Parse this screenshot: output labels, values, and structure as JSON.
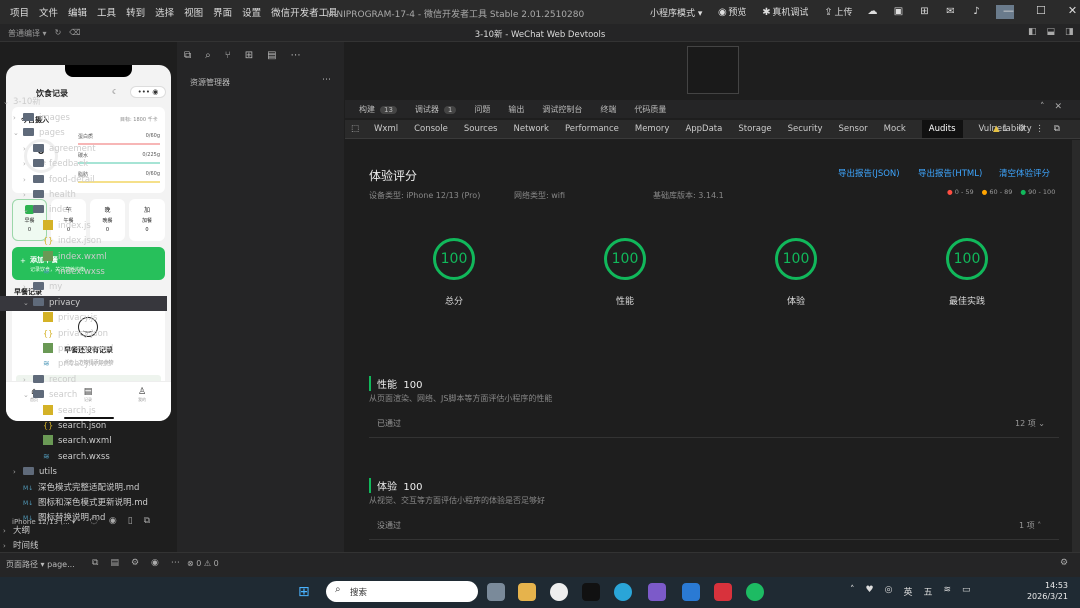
{
  "menu": [
    "项目",
    "文件",
    "编辑",
    "工具",
    "转到",
    "选择",
    "视图",
    "界面",
    "设置",
    "微信开发者工具"
  ],
  "window_title": "MINIPROGRAM-17-4 - 微信开发者工具 Stable 2.01.2510280",
  "top_actions": {
    "mode": "小程序模式",
    "preview": "预览",
    "device": "真机调试",
    "upload": "上传"
  },
  "doc_title": "3-10新 - WeChat Web Devtools",
  "sim": {
    "compile": "普通编译",
    "app_title": "饮食记录",
    "today": "今日摄入",
    "goal": "目标: 1800 千卡",
    "kcal": "0",
    "kcal_unit": "千卡",
    "nutrients": [
      {
        "name": "蛋白质",
        "val": "0/60g"
      },
      {
        "name": "碳水",
        "val": "0/225g"
      },
      {
        "name": "脂肪",
        "val": "0/60g"
      }
    ],
    "meals": [
      {
        "name": "早餐",
        "v": "0"
      },
      {
        "name": "午餐",
        "v": "0"
      },
      {
        "name": "晚餐",
        "v": "0"
      },
      {
        "name": "加餐",
        "v": "0"
      }
    ],
    "add_title": "添加早餐",
    "add_sub": "记录饮食，关注营养均衡",
    "section": "早餐记录",
    "empty": "早餐还没有记录",
    "empty_sub": "点击上方按钮添加食物",
    "nav": [
      {
        "n": "首页"
      },
      {
        "n": "记录"
      },
      {
        "n": "我的"
      }
    ],
    "device": "iPhone 12/13 (...",
    "page_path": "页面路径",
    "page_val": "page..."
  },
  "tree_title": "资源管理器",
  "root": "3-10新",
  "tree": [
    {
      "t": "images",
      "k": "fo",
      "d": 1
    },
    {
      "t": "pages",
      "k": "fo",
      "d": 1
    },
    {
      "t": "agreement",
      "k": "fo",
      "d": 2
    },
    {
      "t": "feedback",
      "k": "fo",
      "d": 2
    },
    {
      "t": "food-detail",
      "k": "fo",
      "d": 2
    },
    {
      "t": "health",
      "k": "fo",
      "d": 2
    },
    {
      "t": "index",
      "k": "fo",
      "d": 2
    },
    {
      "t": "index.js",
      "k": "js",
      "d": 3
    },
    {
      "t": "index.json",
      "k": "jn",
      "d": 3
    },
    {
      "t": "index.wxml",
      "k": "wx",
      "d": 3
    },
    {
      "t": "index.wxss",
      "k": "ws",
      "d": 3
    },
    {
      "t": "my",
      "k": "fo",
      "d": 2
    },
    {
      "t": "privacy",
      "k": "fo",
      "d": 2,
      "sel": true
    },
    {
      "t": "privacy.js",
      "k": "js",
      "d": 3
    },
    {
      "t": "privacy.json",
      "k": "jn",
      "d": 3
    },
    {
      "t": "privacy.wxml",
      "k": "wx",
      "d": 3
    },
    {
      "t": "privacy.wxss",
      "k": "ws",
      "d": 3
    },
    {
      "t": "record",
      "k": "fo",
      "d": 2
    },
    {
      "t": "search",
      "k": "fo",
      "d": 2
    },
    {
      "t": "search.js",
      "k": "js",
      "d": 3
    },
    {
      "t": "search.json",
      "k": "jn",
      "d": 3
    },
    {
      "t": "search.wxml",
      "k": "wx",
      "d": 3
    },
    {
      "t": "search.wxss",
      "k": "ws",
      "d": 3
    },
    {
      "t": "utils",
      "k": "fo",
      "d": 1
    },
    {
      "t": "深色模式完整适配说明.md",
      "k": "md",
      "d": 1
    },
    {
      "t": "图标和深色模式更新说明.md",
      "k": "md",
      "d": 1
    },
    {
      "t": "图标替换说明.md",
      "k": "md",
      "d": 1
    }
  ],
  "tree_footer": [
    "大纲",
    "时间线"
  ],
  "tabs1": [
    {
      "t": "构建",
      "n": "13"
    },
    {
      "t": "调试器",
      "n": "1"
    },
    {
      "t": "问题"
    },
    {
      "t": "输出"
    },
    {
      "t": "调试控制台"
    },
    {
      "t": "终端"
    },
    {
      "t": "代码质量"
    }
  ],
  "tabs2": [
    "Wxml",
    "Console",
    "Sources",
    "Network",
    "Performance",
    "Memory",
    "AppData",
    "Storage",
    "Security",
    "Sensor",
    "Mock",
    "Audits",
    "Vulnerability"
  ],
  "warn_count": "1",
  "audit": {
    "title": "体验评分",
    "device": "设备类型: iPhone 12/13 (Pro)",
    "network": "网络类型: wifi",
    "lib": "基础库版本: 3.14.1",
    "links": [
      "导出报告(JSON)",
      "导出报告(HTML)",
      "清空体验评分"
    ],
    "legend": [
      "0 - 59",
      "60 - 89",
      "90 - 100"
    ],
    "scores": [
      {
        "v": "100",
        "l": "总分"
      },
      {
        "v": "100",
        "l": "性能"
      },
      {
        "v": "100",
        "l": "体验"
      },
      {
        "v": "100",
        "l": "最佳实践"
      }
    ],
    "perf": {
      "h": "性能",
      "v": "100",
      "d": "从页面渲染、网络、JS脚本等方面评估小程序的性能",
      "p": "已通过",
      "c": "12 项"
    },
    "exp": {
      "h": "体验",
      "v": "100",
      "d": "从视觉、交互等方面评估小程序的体验是否足够好",
      "p": "没通过",
      "c": "1 项"
    }
  },
  "status": "⊗ 0 ⚠ 0",
  "taskbar": {
    "search": "搜索",
    "ime1": "英",
    "ime2": "五",
    "time": "14:53",
    "date": "2026/3/21"
  },
  "colors": {
    "green": "#11b85b",
    "link": "#3ea6ff",
    "menubar": "#2b2b2b"
  }
}
